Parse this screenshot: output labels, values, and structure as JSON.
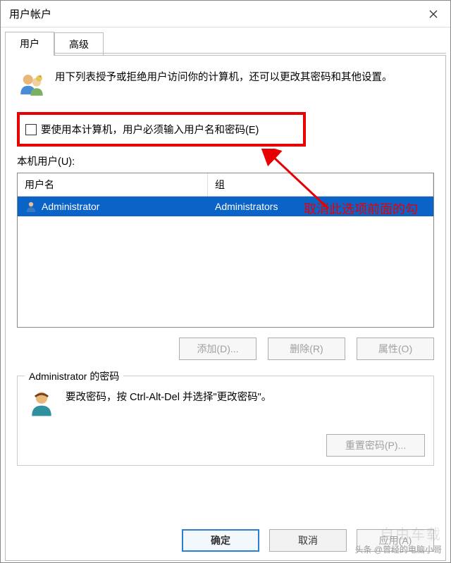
{
  "window": {
    "title": "用户帐户"
  },
  "tabs": {
    "user": "用户",
    "advanced": "高级"
  },
  "intro": {
    "text": "用下列表授予或拒绝用户访问你的计算机，还可以更改其密码和其他设置。"
  },
  "checkbox": {
    "label": "要使用本计算机，用户必须输入用户名和密码(E)"
  },
  "userlist": {
    "label": "本机用户(U):",
    "col_user": "用户名",
    "col_group": "组",
    "rows": [
      {
        "user": "Administrator",
        "group": "Administrators"
      }
    ]
  },
  "buttons": {
    "add": "添加(D)...",
    "remove": "删除(R)",
    "properties": "属性(O)",
    "reset_pwd": "重置密码(P)...",
    "ok": "确定",
    "cancel": "取消",
    "apply": "应用(A)"
  },
  "password_group": {
    "title": "Administrator 的密码",
    "text": "要改密码，按 Ctrl-Alt-Del 并选择\"更改密码\"。"
  },
  "annotation": {
    "text": "取消此选项前面的勾"
  },
  "watermark": {
    "line1": "自由车载",
    "line2": "头条 @曾经的电脑小哥"
  }
}
